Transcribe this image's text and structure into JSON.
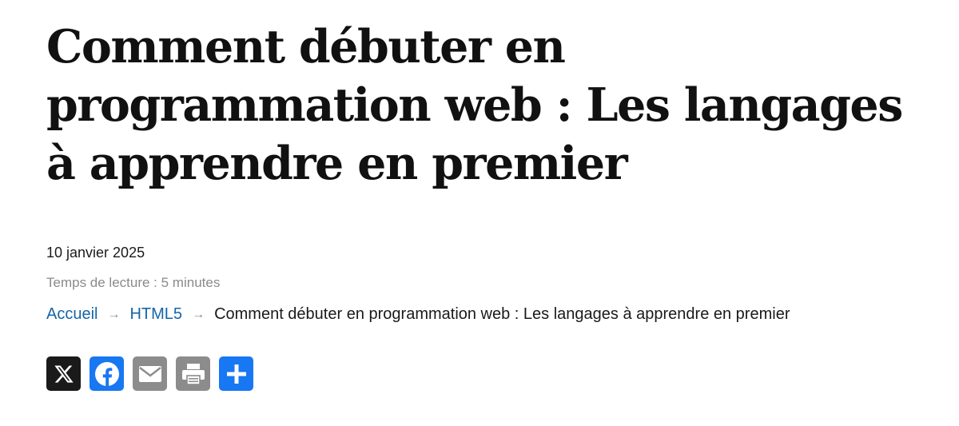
{
  "article": {
    "title": "Comment débuter en programmation web : Les langages à apprendre en premier",
    "date": "10 janvier 2025",
    "reading_time": "Temps de lecture : 5 minutes"
  },
  "breadcrumb": {
    "items": [
      {
        "label": "Accueil"
      },
      {
        "label": "HTML5"
      }
    ],
    "current": "Comment débuter en programmation web : Les langages à apprendre en premier",
    "separator": "→"
  },
  "share": {
    "buttons": [
      {
        "icon": "x-logo-icon",
        "color": "#1a1a1a"
      },
      {
        "icon": "facebook-icon",
        "color": "#1877f2"
      },
      {
        "icon": "email-icon",
        "color": "#8c8c8c"
      },
      {
        "icon": "printer-icon",
        "color": "#8c8c8c"
      },
      {
        "icon": "plus-icon",
        "color": "#1877f2"
      }
    ]
  }
}
